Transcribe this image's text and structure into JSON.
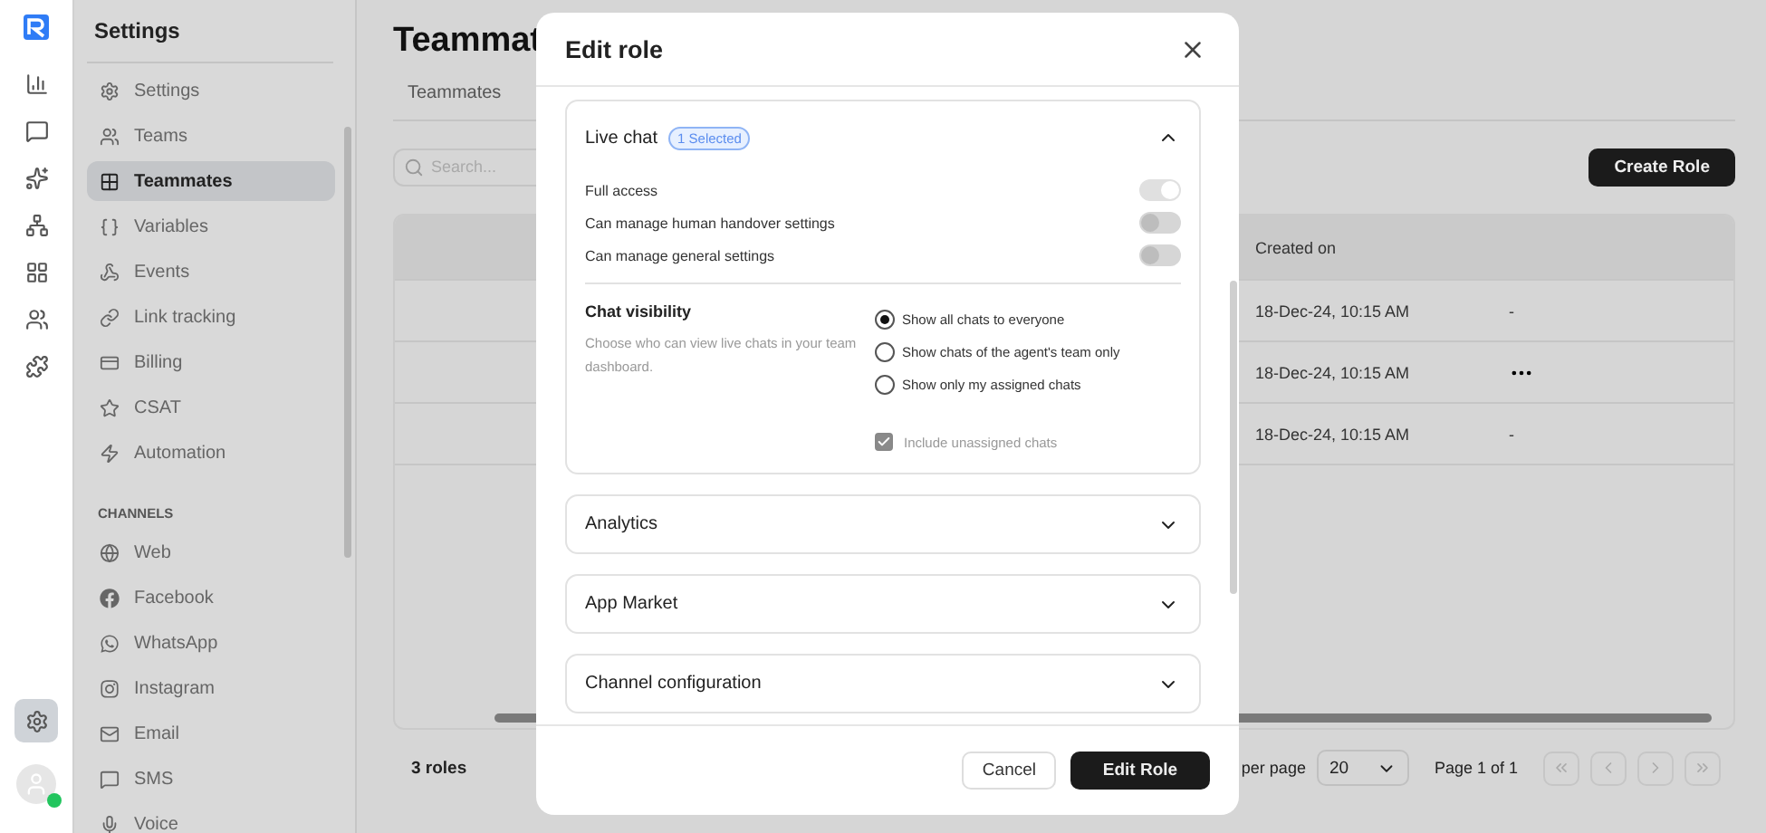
{
  "rail": {
    "items": [
      {
        "selected": false
      },
      {
        "selected": false
      },
      {
        "selected": false
      },
      {
        "selected": false
      },
      {
        "selected": false
      },
      {
        "selected": false
      },
      {
        "selected": false
      }
    ],
    "settings": {
      "selected": true
    },
    "avatar": {
      "online": true
    }
  },
  "sidebar": {
    "title": "Settings",
    "items": [
      {
        "label": "Settings",
        "selected": false
      },
      {
        "label": "Teams",
        "selected": false
      },
      {
        "label": "Teammates",
        "selected": true
      },
      {
        "label": "Variables",
        "selected": false
      },
      {
        "label": "Events",
        "selected": false
      },
      {
        "label": "Link tracking",
        "selected": false
      },
      {
        "label": "Billing",
        "selected": false
      },
      {
        "label": "CSAT",
        "selected": false
      },
      {
        "label": "Automation",
        "selected": false
      }
    ],
    "section": "CHANNELS",
    "channels": [
      {
        "label": "Web",
        "selected": false
      },
      {
        "label": "Facebook",
        "selected": false
      },
      {
        "label": "WhatsApp",
        "selected": false
      },
      {
        "label": "Instagram",
        "selected": false
      },
      {
        "label": "Email",
        "selected": false
      },
      {
        "label": "SMS",
        "selected": false
      },
      {
        "label": "Voice",
        "selected": false
      }
    ]
  },
  "main": {
    "title": "Teammat",
    "tabs": [
      "Teammates"
    ],
    "search": {
      "placeholder": "Search..."
    },
    "create_button": "Create Role",
    "table": {
      "columns": [
        "Created on"
      ],
      "rows": [
        {
          "created_on": "18-Dec-24, 10:15 AM",
          "action": {
            "kind": "dash",
            "text": "-"
          }
        },
        {
          "created_on": "18-Dec-24, 10:15 AM",
          "action": {
            "kind": "menu"
          }
        },
        {
          "created_on": "18-Dec-24, 10:15 AM",
          "action": {
            "kind": "dash",
            "text": "-"
          }
        }
      ]
    },
    "count": "3 roles",
    "per_page_label": "per page",
    "per_page": "20",
    "page": "Page 1 of 1"
  },
  "modal": {
    "title": "Edit role",
    "sections": [
      {
        "title": "Live chat",
        "badge": "1 Selected",
        "expanded": true,
        "toggles": [
          {
            "label": "Full access",
            "on": true
          },
          {
            "label": "Can manage human handover settings",
            "on": false
          },
          {
            "label": "Can manage general settings",
            "on": false
          }
        ],
        "visibility": {
          "title": "Chat visibility",
          "description": "Choose who can view live chats in your team dashboard.",
          "options": [
            {
              "label": "Show all chats to everyone",
              "selected": true
            },
            {
              "label": "Show chats of the agent's team only",
              "selected": false
            },
            {
              "label": "Show only my assigned chats",
              "selected": false
            }
          ],
          "checkbox": {
            "label": "Include unassigned chats",
            "checked": true,
            "disabled": true
          }
        }
      },
      {
        "title": "Analytics",
        "expanded": false
      },
      {
        "title": "App Market",
        "expanded": false
      },
      {
        "title": "Channel configuration",
        "expanded": false
      }
    ],
    "cancel": "Cancel",
    "confirm": "Edit Role"
  }
}
